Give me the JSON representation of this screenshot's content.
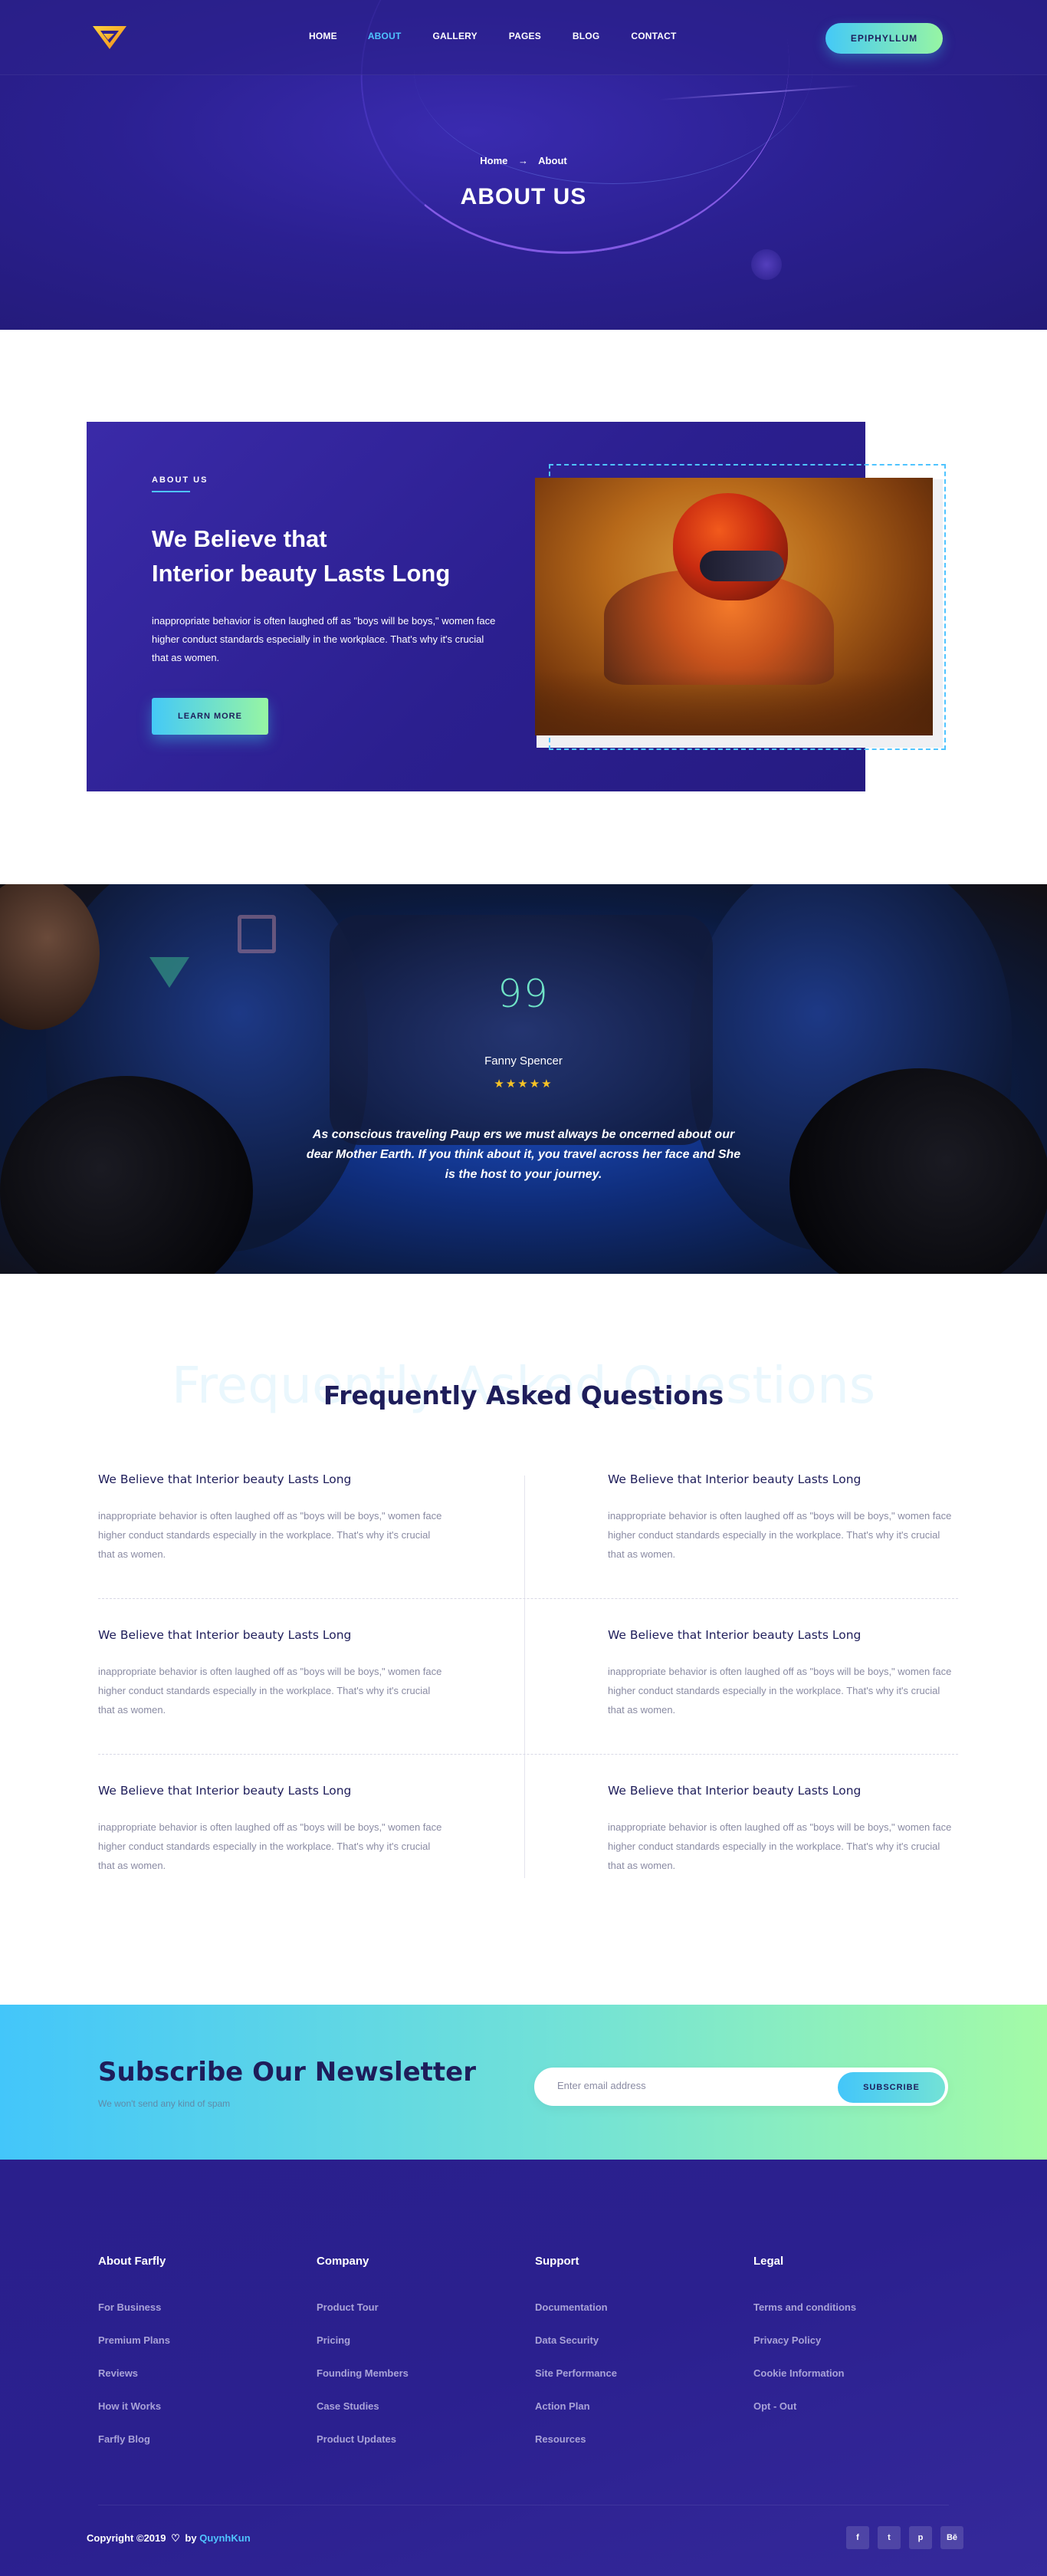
{
  "header": {
    "nav": [
      {
        "label": "HOME",
        "active": false
      },
      {
        "label": "ABOUT",
        "active": true
      },
      {
        "label": "GALLERY",
        "active": false
      },
      {
        "label": "PAGES",
        "active": false
      },
      {
        "label": "BLOG",
        "active": false
      },
      {
        "label": "CONTACT",
        "active": false
      }
    ],
    "cta_label": "EPIPHYLLUM",
    "accent_color": "#4fc4ff"
  },
  "hero": {
    "breadcrumb_home": "Home",
    "breadcrumb_current": "About",
    "title": "ABOUT US"
  },
  "about": {
    "eyebrow": "ABOUT US",
    "heading_line1": "We Believe that",
    "heading_line2": "Interior beauty Lasts Long",
    "text": "inappropriate behavior is often laughed off as \"boys will be boys,\" women face higher conduct standards especially in the workplace. That's why it's crucial that as women.",
    "button_label": "LEARN MORE"
  },
  "testimonial": {
    "quote_mark": "99",
    "name": "Fanny Spencer",
    "rating": 5,
    "stars": "★★★★★",
    "text": "As conscious traveling Paup ers we must always be oncerned about our dear Mother Earth. If you think about it, you travel across her face and She is the host to your journey."
  },
  "faq": {
    "ghost_title": "Frequently Asked Questions",
    "title": "Frequently Asked Questions",
    "items": [
      {
        "q": "We Believe that Interior beauty Lasts Long",
        "a": "inappropriate behavior is often laughed off as \"boys will be boys,\" women face higher conduct standards especially in the workplace. That's why it's crucial that as women."
      },
      {
        "q": "We Believe that Interior beauty Lasts Long",
        "a": "inappropriate behavior is often laughed off as \"boys will be boys,\" women face higher conduct standards especially in the workplace. That's why it's crucial that as women."
      },
      {
        "q": "We Believe that Interior beauty Lasts Long",
        "a": "inappropriate behavior is often laughed off as \"boys will be boys,\" women face higher conduct standards especially in the workplace. That's why it's crucial that as women."
      },
      {
        "q": "We Believe that Interior beauty Lasts Long",
        "a": "inappropriate behavior is often laughed off as \"boys will be boys,\" women face higher conduct standards especially in the workplace. That's why it's crucial that as women."
      },
      {
        "q": "We Believe that Interior beauty Lasts Long",
        "a": "inappropriate behavior is often laughed off as \"boys will be boys,\" women face higher conduct standards especially in the workplace. That's why it's crucial that as women."
      },
      {
        "q": "We Believe that Interior beauty Lasts Long",
        "a": "inappropriate behavior is often laughed off as \"boys will be boys,\" women face higher conduct standards especially in the workplace. That's why it's crucial that as women."
      }
    ]
  },
  "newsletter": {
    "title": "Subscribe Our Newsletter",
    "subtitle": "We won't send any kind of spam",
    "placeholder": "Enter email address",
    "button_label": "SUBSCRIBE"
  },
  "footer": {
    "columns": [
      {
        "title": "About Farfly",
        "links": [
          "For Business",
          "Premium Plans",
          "Reviews",
          "How it Works",
          "Farfly Blog"
        ]
      },
      {
        "title": "Company",
        "links": [
          "Product Tour",
          "Pricing",
          "Founding Members",
          "Case Studies",
          "Product Updates"
        ]
      },
      {
        "title": "Support",
        "links": [
          "Documentation",
          "Data Security",
          "Site Performance",
          "Action Plan",
          "Resources"
        ]
      },
      {
        "title": "Legal",
        "links": [
          "Terms and conditions",
          "Privacy Policy",
          "Cookie Information",
          "Opt - Out"
        ]
      }
    ],
    "copyright_prefix": "Copyright ©2019",
    "copyright_by": "by",
    "copyright_brand": "QuynhKun",
    "socials": [
      {
        "icon": "facebook-icon",
        "glyph": "f"
      },
      {
        "icon": "twitter-icon",
        "glyph": "t"
      },
      {
        "icon": "pinterest-icon",
        "glyph": "p"
      },
      {
        "icon": "behance-icon",
        "glyph": "Bē"
      }
    ]
  }
}
